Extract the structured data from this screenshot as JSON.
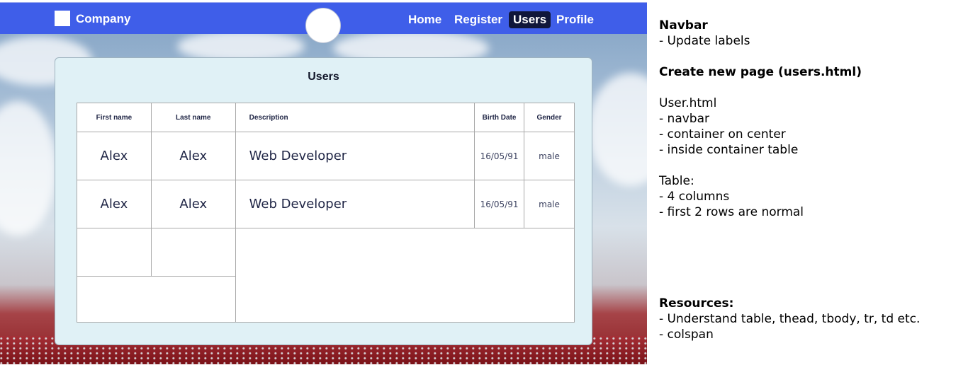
{
  "navbar": {
    "brand": "Company",
    "links": [
      "Home",
      "Register",
      "Users",
      "Profile"
    ],
    "active": "Users",
    "color": "#3f5ee9"
  },
  "panel": {
    "title": "Users",
    "headers": [
      "First name",
      "Last name",
      "Description",
      "Birth Date",
      "Gender"
    ],
    "rows": [
      {
        "first": "Alex",
        "last": "Alex",
        "description": "Web Developer",
        "birth": "16/05/91",
        "gender": "male"
      },
      {
        "first": "Alex",
        "last": "Alex",
        "description": "Web Developer",
        "birth": "16/05/91",
        "gender": "male"
      }
    ]
  },
  "notes": {
    "navbar_title": "Navbar",
    "navbar_item": "- Update labels",
    "create_title": "Create new page (users.html)",
    "user_html": "User.html",
    "user_items": [
      "- navbar",
      "- container on center",
      "- inside container table"
    ],
    "table_title": "Table:",
    "table_items": [
      "- 4 columns",
      "- first 2 rows are normal"
    ],
    "resources_title": "Resources:",
    "resources_items": [
      "- Understand table, thead, tbody, tr, td etc.",
      "- colspan"
    ]
  }
}
